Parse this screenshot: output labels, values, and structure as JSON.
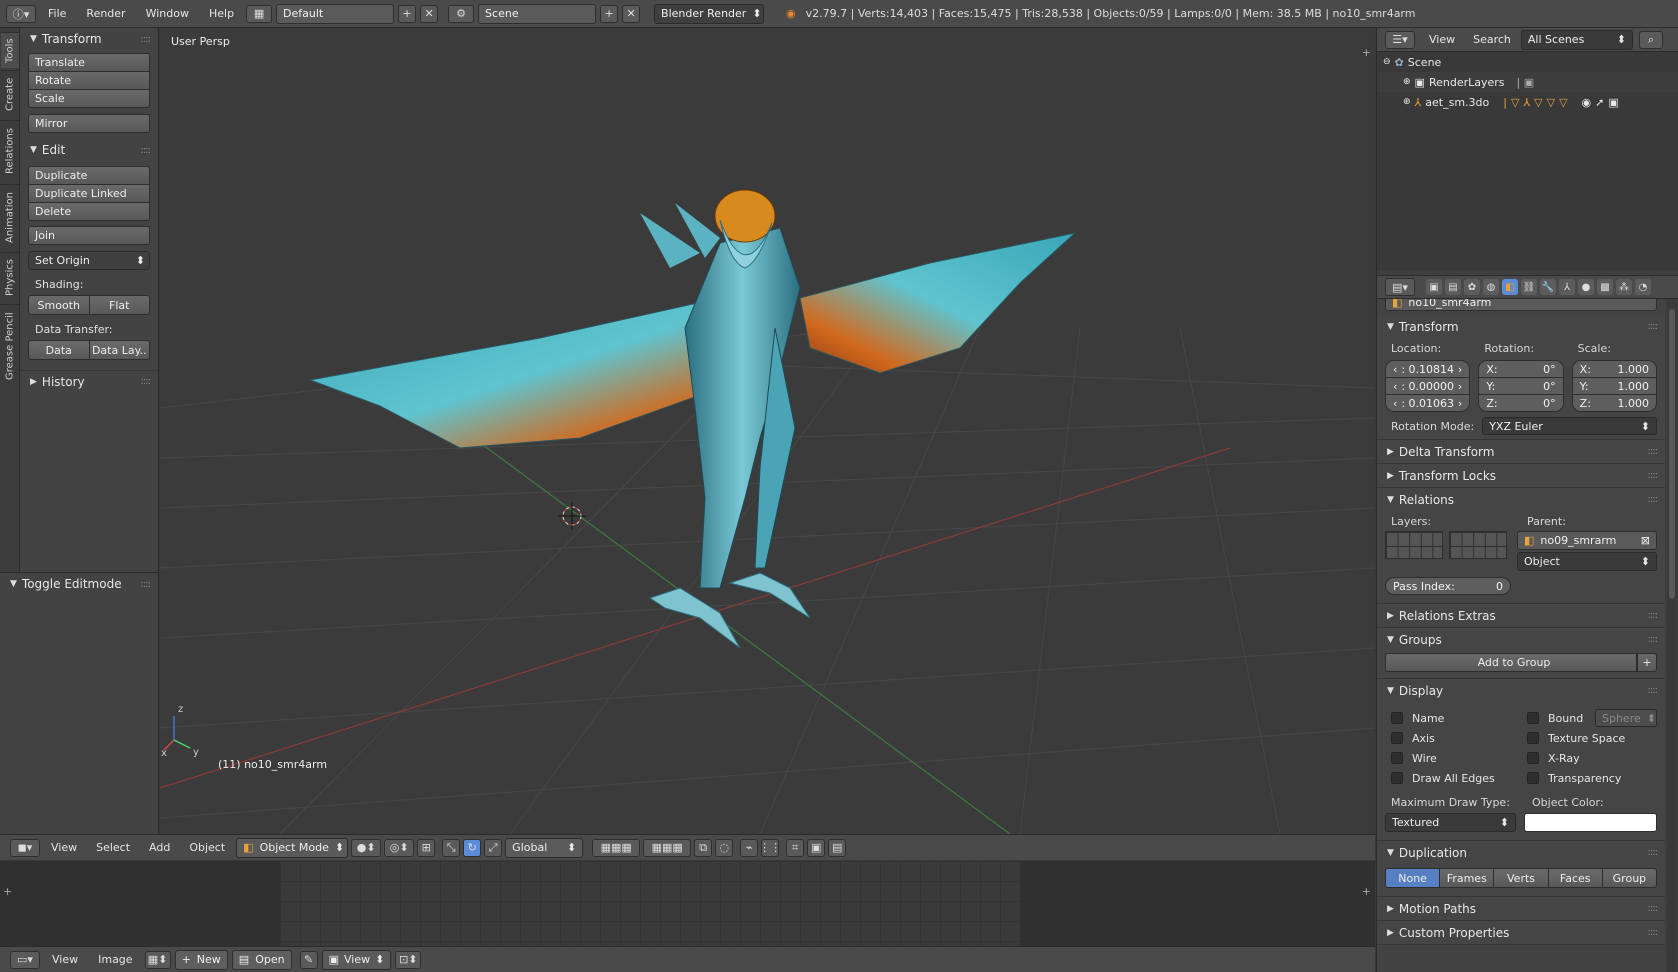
{
  "topbar": {
    "menus": [
      "File",
      "Render",
      "Window",
      "Help"
    ],
    "layout": "Default",
    "scene": "Scene",
    "engine": "Blender Render",
    "stats": "v2.79.7 | Verts:14,403 | Faces:15,475 | Tris:28,538 | Objects:0/59 | Lamps:0/0 | Mem: 38.5 MB | no10_smr4arm"
  },
  "lefttabs": [
    "Tools",
    "Create",
    "Relations",
    "Animation",
    "Physics",
    "Grease Pencil"
  ],
  "toolshelf": {
    "transform": {
      "title": "Transform",
      "buttons": [
        "Translate",
        "Rotate",
        "Scale",
        "Mirror"
      ]
    },
    "edit": {
      "title": "Edit",
      "buttons": [
        "Duplicate",
        "Duplicate Linked",
        "Delete",
        "Join"
      ],
      "set_origin": "Set Origin"
    },
    "shading": {
      "label": "Shading:",
      "smooth": "Smooth",
      "flat": "Flat"
    },
    "data_transfer": {
      "label": "Data Transfer:",
      "data": "Data",
      "data_layout": "Data Lay.."
    },
    "history": "History",
    "toggle_editmode": "Toggle Editmode"
  },
  "viewport": {
    "view_label": "User Persp",
    "object_label": "(11) no10_smr4arm",
    "axis_x": "x",
    "axis_y": "y",
    "axis_z": "z"
  },
  "vpheader": {
    "menus": [
      "View",
      "Select",
      "Add",
      "Object"
    ],
    "mode": "Object Mode",
    "orientation": "Global"
  },
  "imgheader": {
    "menus": [
      "View",
      "Image"
    ],
    "new": "New",
    "open": "Open",
    "view": "View"
  },
  "outliner": {
    "menus": [
      "View",
      "Search"
    ],
    "filter": "All Scenes",
    "items": [
      {
        "label": "Scene",
        "indent": 0
      },
      {
        "label": "RenderLayers",
        "indent": 1
      },
      {
        "label": "aet_sm.3do",
        "indent": 1
      }
    ]
  },
  "props": {
    "object_name": "no10_smr4arm",
    "transform": {
      "title": "Transform",
      "location_label": "Location:",
      "rotation_label": "Rotation:",
      "scale_label": "Scale:",
      "location": [
        ":  0.10814",
        ":  0.00000",
        ":  0.01063"
      ],
      "rotation": [
        {
          "axis": "X:",
          "value": "0°"
        },
        {
          "axis": "Y:",
          "value": "0°"
        },
        {
          "axis": "Z:",
          "value": "0°"
        }
      ],
      "scale": [
        {
          "axis": "X:",
          "value": "1.000"
        },
        {
          "axis": "Y:",
          "value": "1.000"
        },
        {
          "axis": "Z:",
          "value": "1.000"
        }
      ],
      "rotation_mode_label": "Rotation Mode:",
      "rotation_mode": "YXZ Euler"
    },
    "delta_transform": "Delta Transform",
    "transform_locks": "Transform Locks",
    "relations": {
      "title": "Relations",
      "layers_label": "Layers:",
      "parent_label": "Parent:",
      "parent": "no09_smrarm",
      "parent_type": "Object",
      "pass_index_label": "Pass Index:",
      "pass_index": "0"
    },
    "relations_extras": "Relations Extras",
    "groups": {
      "title": "Groups",
      "add": "Add to Group"
    },
    "display": {
      "title": "Display",
      "left": [
        "Name",
        "Axis",
        "Wire",
        "Draw All Edges"
      ],
      "right": [
        "Bound",
        "Texture Space",
        "X-Ray",
        "Transparency"
      ],
      "bound_type": "Sphere",
      "max_draw_label": "Maximum Draw Type:",
      "max_draw": "Textured",
      "object_color_label": "Object Color:",
      "object_color": "#ffffff"
    },
    "duplication": {
      "title": "Duplication",
      "options": [
        "None",
        "Frames",
        "Verts",
        "Faces",
        "Group"
      ],
      "active": "None"
    },
    "motion_paths": "Motion Paths",
    "custom_properties": "Custom Properties"
  }
}
